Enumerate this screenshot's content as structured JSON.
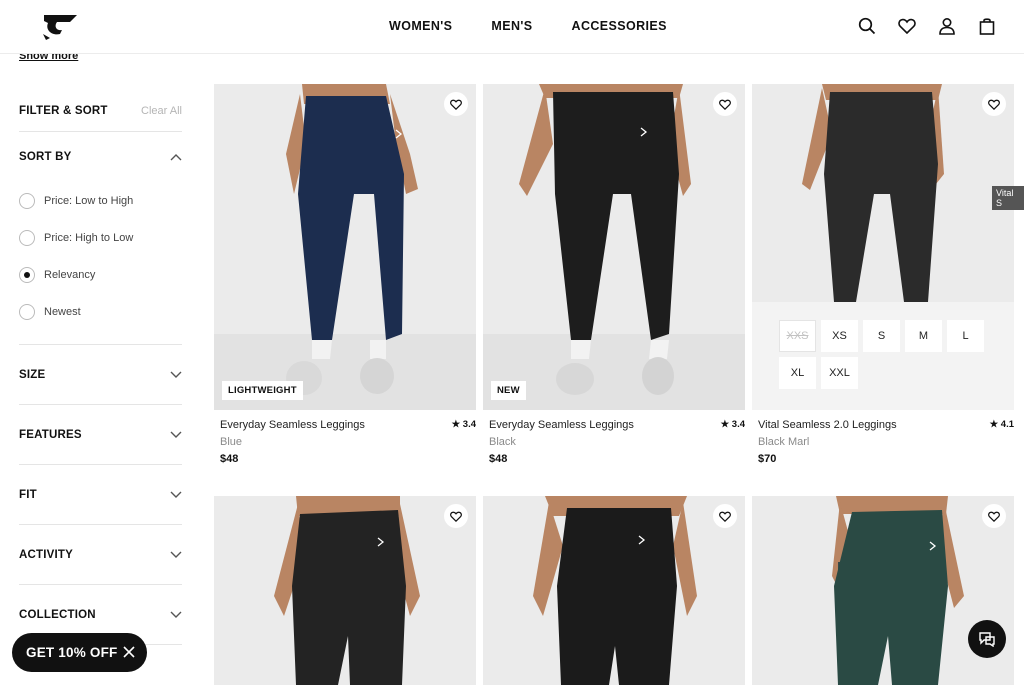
{
  "header": {
    "nav": [
      "WOMEN'S",
      "MEN'S",
      "ACCESSORIES"
    ],
    "icons": [
      "search-icon",
      "heart-icon",
      "account-icon",
      "bag-icon"
    ]
  },
  "sidebar": {
    "show_more": "Show more",
    "filter_sort": "FILTER & SORT",
    "clear_all": "Clear All",
    "sort_by": {
      "title": "SORT BY",
      "options": [
        "Price: Low to High",
        "Price: High to Low",
        "Relevancy",
        "Newest"
      ],
      "selected": "Relevancy"
    },
    "sections": [
      "SIZE",
      "FEATURES",
      "FIT",
      "ACTIVITY",
      "COLLECTION"
    ]
  },
  "products": [
    {
      "name": "Everyday Seamless Leggings",
      "color": "Blue",
      "price": "$48",
      "rating": "3.4",
      "badge": "LIGHTWEIGHT"
    },
    {
      "name": "Everyday Seamless Leggings",
      "color": "Black",
      "price": "$48",
      "rating": "3.4",
      "badge": "NEW"
    },
    {
      "name": "Vital Seamless 2.0 Leggings",
      "color": "Black Marl",
      "price": "$70",
      "rating": "4.1",
      "badge": ""
    }
  ],
  "sizes": [
    "XXS",
    "XS",
    "S",
    "M",
    "L",
    "XL",
    "XXL"
  ],
  "tooltip": "Vital S",
  "promo": {
    "label": "GET 10% OFF"
  },
  "colors": {
    "navy": "#1c2d4f",
    "black": "#1a1a1a",
    "charcoal": "#2b2b2b",
    "green": "#2a4a44",
    "skin": "#b98563"
  }
}
